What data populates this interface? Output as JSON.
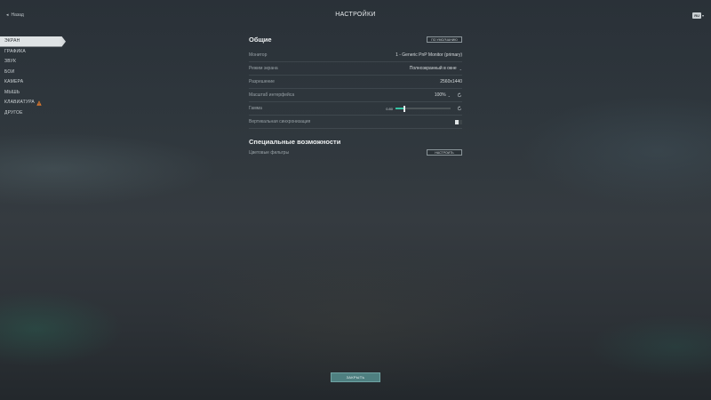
{
  "topbar": {
    "back_label": "Назад",
    "title": "НАСТРОЙКИ",
    "language": "RU"
  },
  "sidebar": {
    "items": [
      {
        "label": "ЭКРАН",
        "active": true
      },
      {
        "label": "ГРАФИКА",
        "active": false
      },
      {
        "label": "ЗВУК",
        "active": false
      },
      {
        "label": "БОИ",
        "active": false
      },
      {
        "label": "КАМЕРА",
        "active": false
      },
      {
        "label": "МЫШЬ",
        "active": false
      },
      {
        "label": "КЛАВИАТУРА",
        "active": false,
        "warning": true
      },
      {
        "label": "ДРУГОЕ",
        "active": false
      }
    ]
  },
  "general": {
    "title": "Общие",
    "defaults_button": "ПО УМОЛЧАНИЮ",
    "monitor_label": "Монитор",
    "monitor_value": "1 - Generic PnP Monitor (primary)",
    "screen_mode_label": "Режим экрана",
    "screen_mode_value": "Полноэкранный в окне",
    "resolution_label": "Разрешение",
    "resolution_value": "2560x1440",
    "ui_scale_label": "Масштаб интерфейса",
    "ui_scale_value": "100%",
    "gamma_label": "Гамма",
    "gamma_value": "0.80",
    "gamma_fraction": 0.16,
    "vsync_label": "Вертикальная синхронизация",
    "vsync_on": false
  },
  "accessibility": {
    "title": "Специальные возможности",
    "color_filters_label": "Цветовые фильтры",
    "configure_button": "НАСТРОИТЬ"
  },
  "footer": {
    "close_button": "ЗАКРЫТЬ"
  },
  "colors": {
    "accent": "#36c3a3",
    "close_button_bg": "#4e7f80",
    "warning": "#e07a2e"
  }
}
